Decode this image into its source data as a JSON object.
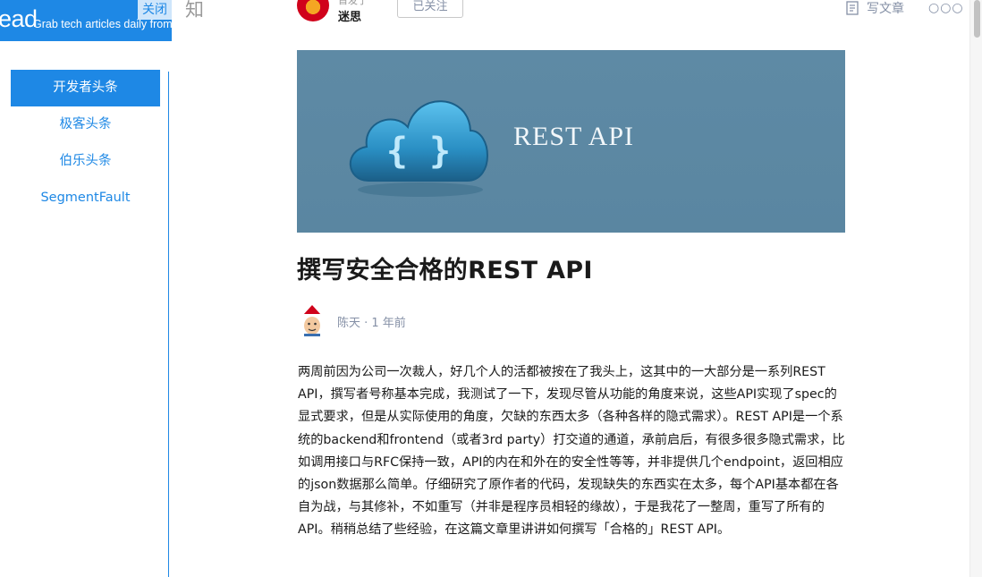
{
  "reader": {
    "brand": "ead",
    "tagline": "Grab tech articles daily from",
    "close_label": "关闭",
    "nav_items": [
      {
        "label": "开发者头条",
        "active": true
      },
      {
        "label": "极客头条",
        "active": false
      },
      {
        "label": "伯乐头条",
        "active": false
      },
      {
        "label": "SegmentFault",
        "active": false
      }
    ]
  },
  "topbar": {
    "site_logo": "知",
    "author_subtitle": "首发于",
    "author_name": "迷思",
    "follow_label": "已关注",
    "write_label": "写文章",
    "more_label": "○○○"
  },
  "article": {
    "banner_text": "REST API",
    "banner_icon_text": "{ }",
    "title": "撰写安全合格的REST API",
    "byline": "陈天 · 1 年前",
    "body": "两周前因为公司一次裁人，好几个人的活都被按在了我头上，这其中的一大部分是一系列REST API，撰写者号称基本完成，我测试了一下，发现尽管从功能的角度来说，这些API实现了spec的显式要求，但是从实际使用的角度，欠缺的东西太多（各种各样的隐式需求）。REST API是一个系统的backend和frontend（或者3rd party）打交道的通道，承前启后，有很多很多隐式需求，比如调用接口与RFC保持一致，API的内在和外在的安全性等等，并非提供几个endpoint，返回相应的json数据那么简单。仔细研究了原作者的代码，发现缺失的东西实在太多，每个API基本都在各自为战，与其修补，不如重写（并非是程序员相轻的缘故），于是我花了一整周，重写了所有的API。稍稍总结了些经验，在这篇文章里讲讲如何撰写「合格的」REST API。"
  },
  "colors": {
    "accent": "#1e88e5",
    "banner": "#5e8aa5",
    "muted": "#8590a6"
  }
}
